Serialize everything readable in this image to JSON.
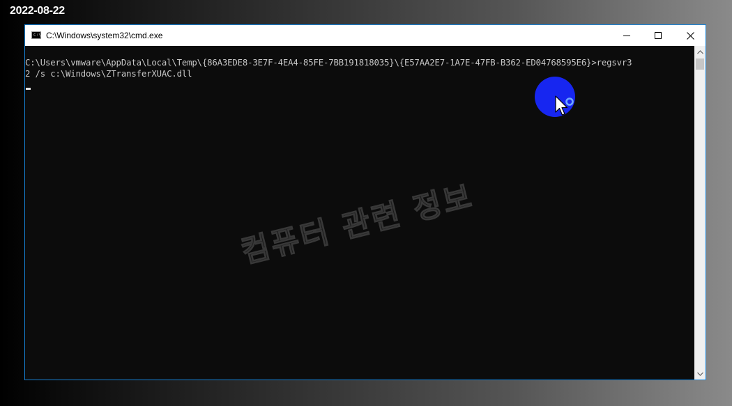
{
  "overlay": {
    "date": "2022-08-22"
  },
  "window": {
    "title": "C:\\Windows\\system32\\cmd.exe",
    "icon": "C:\\",
    "app_icon_name": "cmd-icon",
    "controls": {
      "minimize": "minimize-icon",
      "maximize": "maximize-icon",
      "close": "close-icon"
    },
    "accent_color": "#1883d7"
  },
  "console": {
    "lines": [
      "C:\\Users\\vmware\\AppData\\Local\\Temp\\{86A3EDE8-3E7F-4EA4-85FE-7BB191818035}\\{E57AA2E7-1A7E-47FB-B362-ED04768595E6}>regsvr3",
      "2 /s c:\\Windows\\ZTransferXUAC.dll"
    ],
    "background_color": "#0c0c0c",
    "text_color": "#c8c8c8"
  },
  "watermark": {
    "text": "컴퓨터 관련 정보"
  },
  "scrollbar": {
    "up_icon": "chevron-up-icon",
    "down_icon": "chevron-down-icon"
  },
  "pointer": {
    "highlight_color": "#1726f0",
    "icon": "mouse-pointer-busy-icon"
  }
}
